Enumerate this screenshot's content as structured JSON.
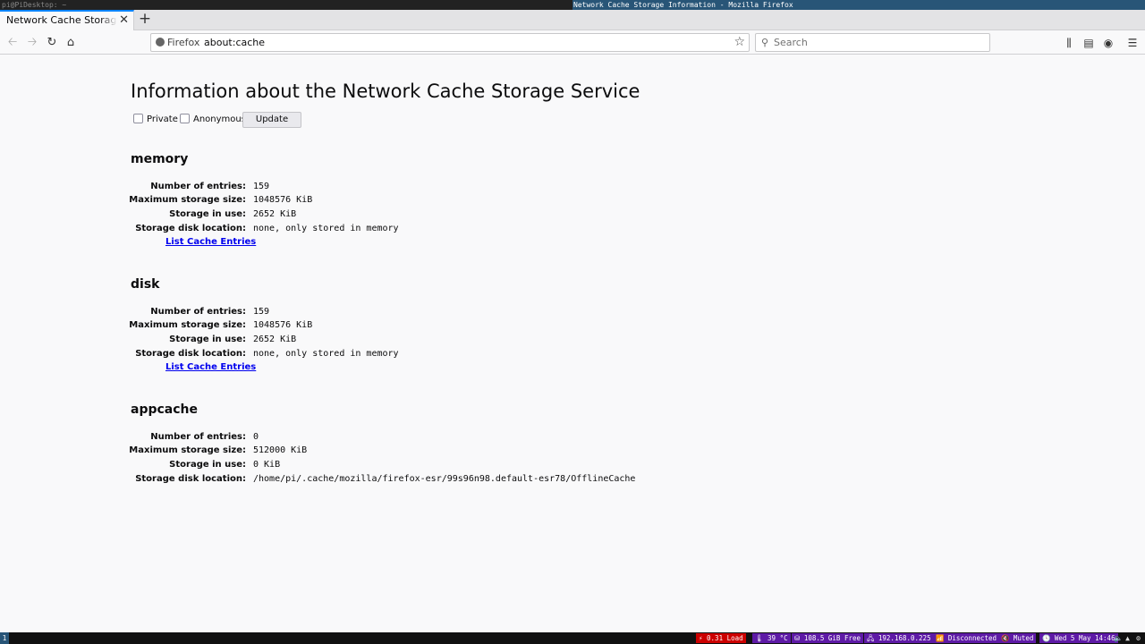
{
  "wm": {
    "left_text": "pi@PiDesktop: ~",
    "window_title": "Network Cache Storage Information - Mozilla Firefox"
  },
  "tabs": [
    {
      "label": "Network Cache Storage Information",
      "active": true
    }
  ],
  "nav": {
    "identity_label": "Firefox",
    "url": "about:cache",
    "search_placeholder": "Search",
    "icons": {
      "back": "back-arrow-icon",
      "forward": "forward-arrow-icon",
      "reload": "reload-icon",
      "home": "home-icon",
      "bookmark": "star-icon",
      "library": "library-icon",
      "sidebar": "sidebar-icon",
      "account": "account-icon",
      "menu": "hamburger-menu-icon"
    }
  },
  "page": {
    "title": "Information about the Network Cache Storage Service",
    "options": {
      "private_label": "Private",
      "private_checked": false,
      "anonymous_label": "Anonymous",
      "anonymous_checked": false,
      "update_label": "Update"
    },
    "labels": {
      "entries": "Number of entries:",
      "max_size": "Maximum storage size:",
      "in_use": "Storage in use:",
      "location": "Storage disk location:"
    },
    "list_link": "List Cache Entries",
    "sections": [
      {
        "name": "memory",
        "entries": "159",
        "max_size": "1048576 KiB",
        "in_use": "2652 KiB",
        "location": "none, only stored in memory",
        "has_link": true
      },
      {
        "name": "disk",
        "entries": "159",
        "max_size": "1048576 KiB",
        "in_use": "2652 KiB",
        "location": "none, only stored in memory",
        "has_link": true
      },
      {
        "name": "appcache",
        "entries": "0",
        "max_size": "512000 KiB",
        "in_use": "0 KiB",
        "location": "/home/pi/.cache/mozilla/firefox-esr/99s96n98.default-esr78/OfflineCache",
        "has_link": false
      }
    ]
  },
  "statusbar": {
    "workspace": "1",
    "blocks": [
      {
        "text": "0.31 Load",
        "color": "#cc0000"
      },
      {
        "text": "39 °C",
        "color": "#5e1aa6"
      },
      {
        "text": "108.5 GiB Free",
        "color": "#5e1aa6"
      },
      {
        "text": "192.168.0.225",
        "color": "#5e1aa6"
      },
      {
        "text": "Disconnected",
        "color": "#5e1aa6"
      },
      {
        "text": "Muted",
        "color": "#5e1aa6"
      },
      {
        "text": "Wed 5 May 14:46",
        "color": "#5e1aa6"
      }
    ]
  }
}
